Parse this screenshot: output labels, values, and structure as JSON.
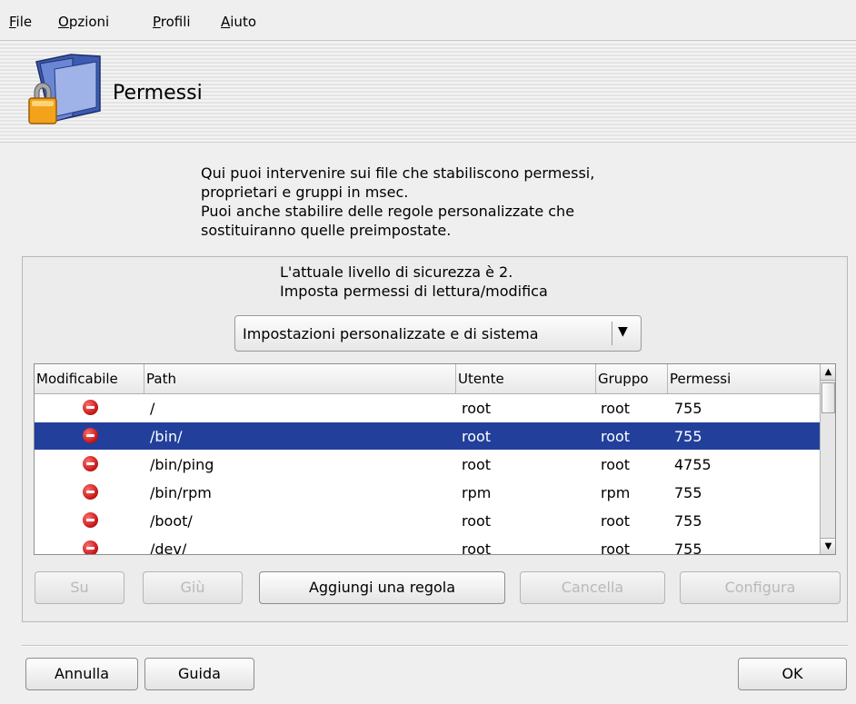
{
  "menu": [
    "File",
    "Opzioni",
    "Profili",
    "Aiuto"
  ],
  "banner": {
    "title": "Permessi",
    "icon": "folder-lock-icon"
  },
  "intro": [
    "Qui puoi intervenire sui file che stabiliscono permessi,",
    "proprietari e gruppi in msec.",
    "Puoi anche stabilire delle regole personalizzate che",
    "sostituiranno quelle preimpostate."
  ],
  "level": [
    "L'attuale livello di sicurezza è 2.",
    "Imposta permessi di lettura/modifica"
  ],
  "filter": {
    "selected": "Impostazioni personalizzate e di sistema"
  },
  "table": {
    "columns": [
      "Modificabile",
      "Path",
      "Utente",
      "Gruppo",
      "Permessi"
    ],
    "rows": [
      {
        "editable_icon": "no-entry-icon",
        "path": "/",
        "user": "root",
        "group": "root",
        "perm": "755",
        "selected": false
      },
      {
        "editable_icon": "no-entry-icon",
        "path": "/bin/",
        "user": "root",
        "group": "root",
        "perm": "755",
        "selected": true
      },
      {
        "editable_icon": "no-entry-icon",
        "path": "/bin/ping",
        "user": "root",
        "group": "root",
        "perm": "4755",
        "selected": false
      },
      {
        "editable_icon": "no-entry-icon",
        "path": "/bin/rpm",
        "user": "rpm",
        "group": "rpm",
        "perm": "755",
        "selected": false
      },
      {
        "editable_icon": "no-entry-icon",
        "path": "/boot/",
        "user": "root",
        "group": "root",
        "perm": "755",
        "selected": false
      },
      {
        "editable_icon": "no-entry-icon",
        "path": "/dev/",
        "user": "root",
        "group": "root",
        "perm": "755",
        "selected": false
      }
    ]
  },
  "actions": {
    "up": "Su",
    "down": "Giù",
    "add_rule": "Aggiungi una regola",
    "delete": "Cancella",
    "configure": "Configura"
  },
  "footer": {
    "cancel": "Annulla",
    "help": "Guida",
    "ok": "OK"
  },
  "colors": {
    "selection": "#22409b",
    "window_bg": "#efefef"
  }
}
